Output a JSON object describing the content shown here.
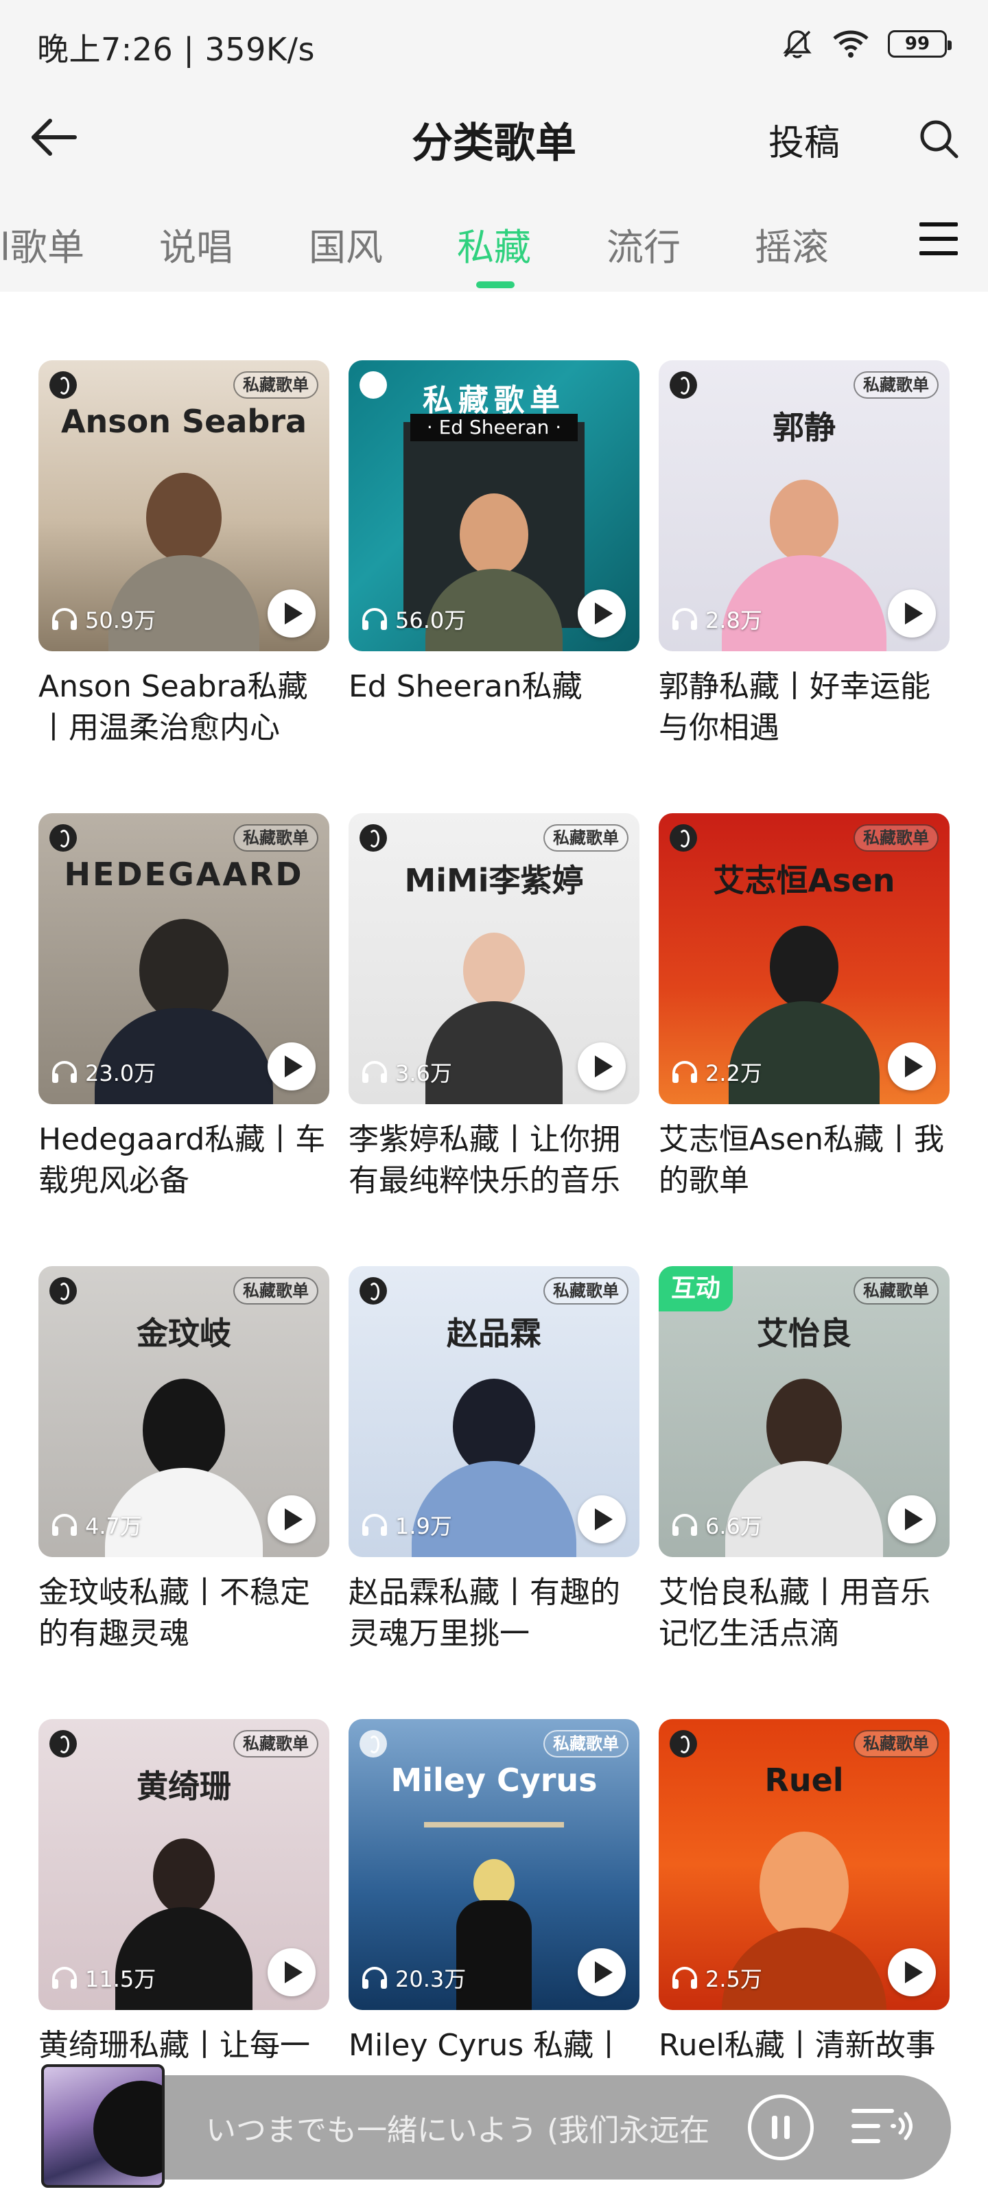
{
  "status_bar": {
    "time_speed": "晚上7:26 | 359K/s",
    "battery": "99",
    "icons": [
      "mute-bell-icon",
      "wifi-icon",
      "battery-icon"
    ]
  },
  "header": {
    "title": "分类歌单",
    "submit_label": "投稿",
    "icons": [
      "back-arrow-icon",
      "search-icon"
    ]
  },
  "tabs": {
    "items": [
      "l歌单",
      "说唱",
      "国风",
      "私藏",
      "流行",
      "摇滚"
    ],
    "active": "私藏",
    "accent_color": "#2fd17e"
  },
  "cards": [
    {
      "cover_name": "Anson Seabra",
      "tag": "私藏歌单",
      "plays": "50.9万",
      "title": "Anson Seabra私藏丨用温柔治愈内心"
    },
    {
      "cover_name": "私藏歌单",
      "cover_sub": "· Ed Sheeran ·",
      "plays": "56.0万",
      "title": "Ed Sheeran私藏"
    },
    {
      "cover_name": "郭静",
      "tag": "私藏歌单",
      "plays": "2.8万",
      "title": "郭静私藏丨好幸运能与你相遇"
    },
    {
      "cover_name": "HEDEGAARD",
      "tag": "私藏歌单",
      "plays": "23.0万",
      "title": "Hedegaard私藏丨车载兜风必备"
    },
    {
      "cover_name": "MiMi李紫婷",
      "tag": "私藏歌单",
      "plays": "3.6万",
      "title": "李紫婷私藏丨让你拥有最纯粹快乐的音乐"
    },
    {
      "cover_name": "艾志恒Asen",
      "tag": "私藏歌单",
      "plays": "2.2万",
      "title": "艾志恒Asen私藏丨我的歌单"
    },
    {
      "cover_name": "金玟岐",
      "tag": "私藏歌单",
      "plays": "4.7万",
      "title": "金玟岐私藏丨不稳定的有趣灵魂"
    },
    {
      "cover_name": "赵品霖",
      "tag": "私藏歌单",
      "plays": "1.9万",
      "title": "赵品霖私藏丨有趣的灵魂万里挑一"
    },
    {
      "cover_name": "艾怡良",
      "tag": "私藏歌单",
      "badge": "互动",
      "plays": "6.6万",
      "title": "艾怡良私藏丨用音乐记忆生活点滴"
    },
    {
      "cover_name": "黄绮珊",
      "tag": "私藏歌单",
      "plays": "11.5万",
      "title": "黄绮珊私藏丨让每一"
    },
    {
      "cover_name": "Miley Cyrus",
      "tag": "私藏歌单",
      "plays": "20.3万",
      "title": "Miley Cyrus 私藏丨"
    },
    {
      "cover_name": "Ruel",
      "tag": "私藏歌单",
      "plays": "2.5万",
      "title": "Ruel私藏丨清新故事"
    }
  ],
  "player": {
    "now_playing": "いつまでも一緒にいよう (我们永远在",
    "icons": [
      "pause-icon",
      "playlist-queue-icon"
    ]
  }
}
